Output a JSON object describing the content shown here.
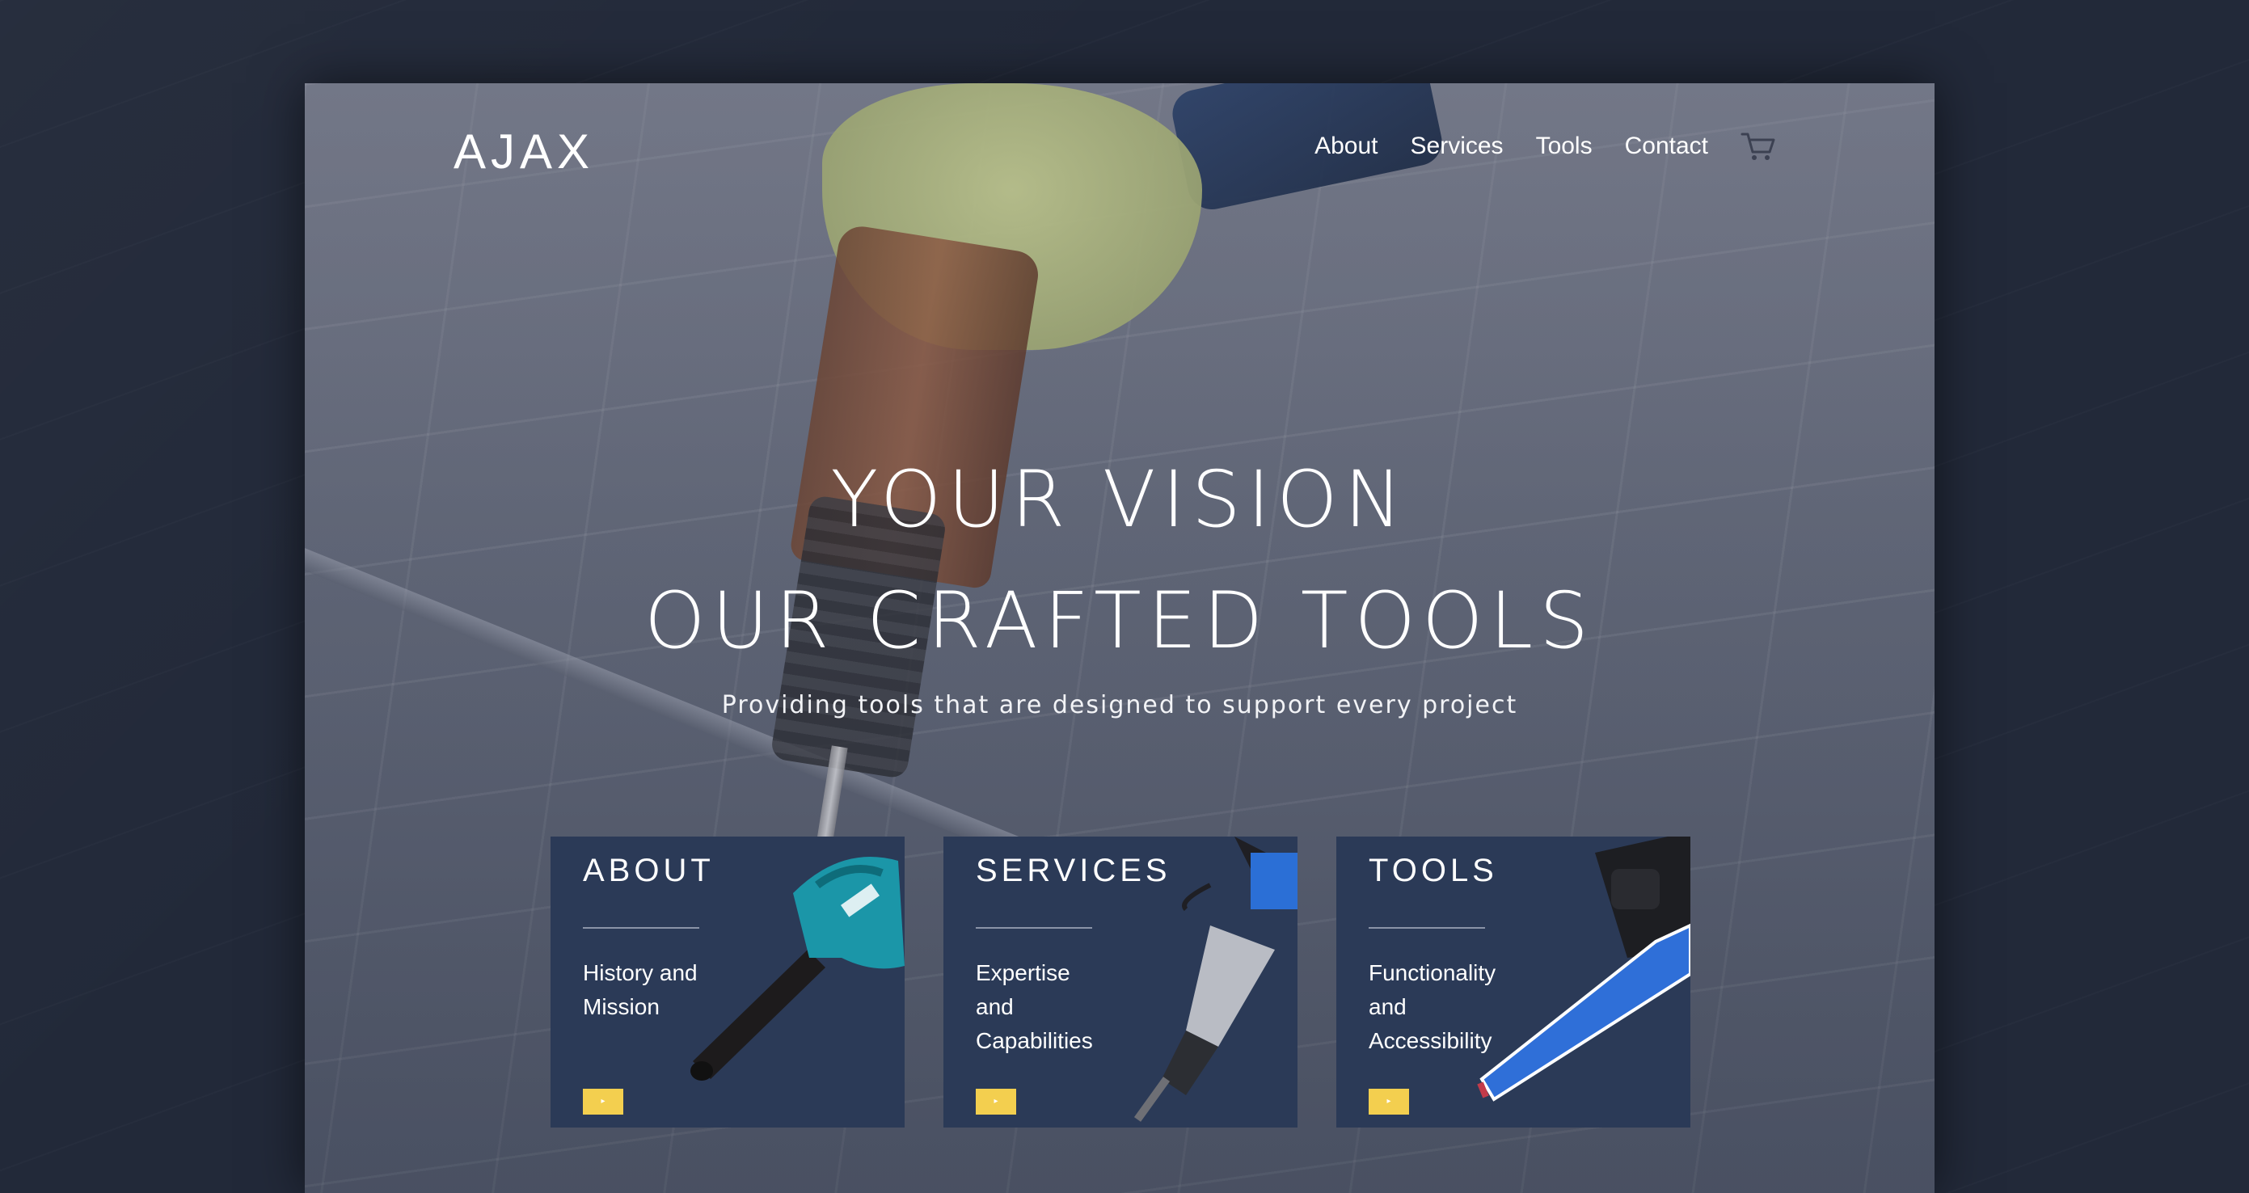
{
  "brand": {
    "logo": "AJAX"
  },
  "nav": {
    "items": [
      {
        "label": "About"
      },
      {
        "label": "Services"
      },
      {
        "label": "Tools"
      },
      {
        "label": "Contact"
      }
    ],
    "cart_icon": "shopping-cart-icon"
  },
  "hero": {
    "title_line1": "YOUR VISION",
    "title_line2": "OUR CRAFTED TOOLS",
    "subtitle": "Providing tools that are designed to support every project"
  },
  "cards": [
    {
      "title": "ABOUT",
      "description": "History and Mission",
      "button_icon": "play-icon",
      "image": "leaf-blower"
    },
    {
      "title": "SERVICES",
      "description": "Expertise and Capabilities",
      "button_icon": "play-icon",
      "image": "jackhammer"
    },
    {
      "title": "TOOLS",
      "description": "Functionality and Accessibility",
      "button_icon": "play-icon",
      "image": "chainsaw"
    }
  ],
  "colors": {
    "card_background": "#2b3a57",
    "button_accent": "#f3cf4f",
    "page_background": "#232a3b",
    "text": "#ffffff"
  }
}
